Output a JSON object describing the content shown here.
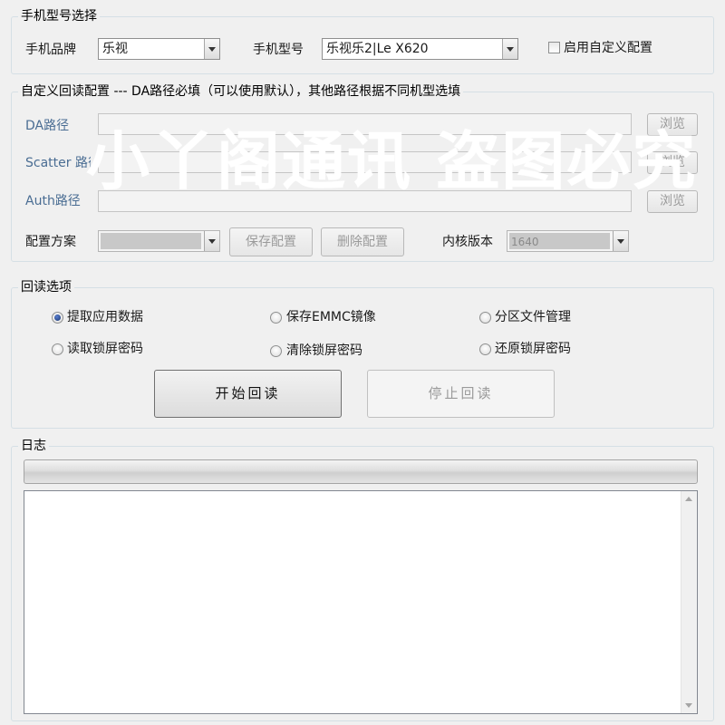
{
  "model_group": {
    "title": "手机型号选择",
    "brand_label": "手机品牌",
    "brand_value": "乐视",
    "model_label": "手机型号",
    "model_value": "乐视乐2|Le X620",
    "custom_config_label": "启用自定义配置",
    "custom_config_checked": false
  },
  "custom_group": {
    "title": "自定义回读配置   ---  DA路径必填（可以使用默认），其他路径根据不同机型选填",
    "da_label": "DA路径",
    "scatter_label": "Scatter 路径",
    "auth_label": "Auth路径",
    "browse_label": "浏览",
    "scheme_label": "配置方案",
    "scheme_value": "",
    "save_config_label": "保存配置",
    "delete_config_label": "删除配置",
    "kernel_label": "内核版本",
    "kernel_value": "1640"
  },
  "readback_group": {
    "title": "回读选项",
    "options": [
      {
        "label": "提取应用数据",
        "selected": true
      },
      {
        "label": "保存EMMC镜像",
        "selected": false
      },
      {
        "label": "分区文件管理",
        "selected": false
      },
      {
        "label": "读取锁屏密码",
        "selected": false
      },
      {
        "label": "清除锁屏密码",
        "selected": false
      },
      {
        "label": "还原锁屏密码",
        "selected": false
      }
    ],
    "start_label": "开始回读",
    "stop_label": "停止回读"
  },
  "log_group": {
    "title": "日志",
    "progress": 0,
    "log_text": ""
  },
  "watermark": "小丫阁通讯 盗图必究"
}
